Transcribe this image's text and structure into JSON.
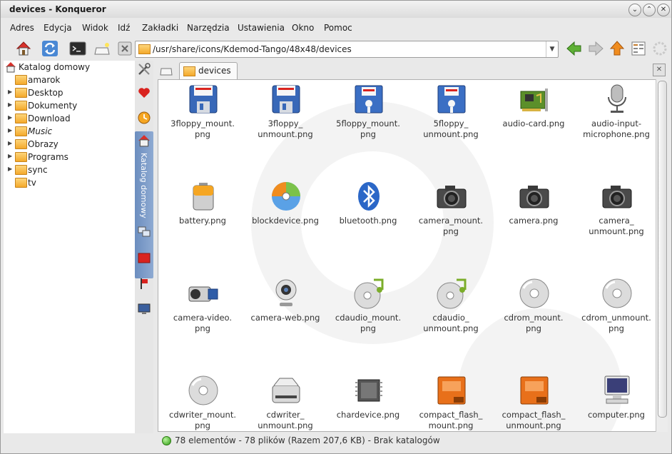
{
  "window": {
    "title": "devices - Konqueror"
  },
  "menu": [
    "Adres",
    "Edycja",
    "Widok",
    "Idź",
    "Zakładki",
    "Narzędzia",
    "Ustawienia",
    "Okno",
    "Pomoc"
  ],
  "location": {
    "url": "/usr/share/icons/Kdemod-Tango/48x48/devices"
  },
  "tab": {
    "label": "devices"
  },
  "sidebar": {
    "root": "Katalog domowy",
    "items": [
      {
        "label": "amarok",
        "expandable": false,
        "italic": false
      },
      {
        "label": "Desktop",
        "expandable": true,
        "italic": false
      },
      {
        "label": "Dokumenty",
        "expandable": true,
        "italic": false
      },
      {
        "label": "Download",
        "expandable": true,
        "italic": false
      },
      {
        "label": "Music",
        "expandable": true,
        "italic": true
      },
      {
        "label": "Obrazy",
        "expandable": true,
        "italic": false
      },
      {
        "label": "Programs",
        "expandable": true,
        "italic": false
      },
      {
        "label": "sync",
        "expandable": true,
        "italic": false
      },
      {
        "label": "tv",
        "expandable": false,
        "italic": false
      }
    ],
    "vertical_tab_label": "Katalog domowy"
  },
  "files": [
    {
      "label": "3floppy_mount.\npng",
      "icon": "floppy-icon"
    },
    {
      "label": "3floppy_\nunmount.png",
      "icon": "floppy-icon"
    },
    {
      "label": "5floppy_mount.\npng",
      "icon": "floppy-5-icon"
    },
    {
      "label": "5floppy_\nunmount.png",
      "icon": "floppy-5-icon"
    },
    {
      "label": "audio-card.png",
      "icon": "audio-card-icon"
    },
    {
      "label": "audio-input-\nmicrophone.png",
      "icon": "microphone-icon"
    },
    {
      "label": "battery.png",
      "icon": "battery-icon"
    },
    {
      "label": "blockdevice.png",
      "icon": "blockdevice-icon"
    },
    {
      "label": "bluetooth.png",
      "icon": "bluetooth-icon"
    },
    {
      "label": "camera_mount.\npng",
      "icon": "camera-icon"
    },
    {
      "label": "camera.png",
      "icon": "camera-icon"
    },
    {
      "label": "camera_\nunmount.png",
      "icon": "camera-icon"
    },
    {
      "label": "camera-video.\npng",
      "icon": "camera-video-icon"
    },
    {
      "label": "camera-web.png",
      "icon": "webcam-icon"
    },
    {
      "label": "cdaudio_mount.\npng",
      "icon": "cdaudio-icon"
    },
    {
      "label": "cdaudio_\nunmount.png",
      "icon": "cdaudio-icon"
    },
    {
      "label": "cdrom_mount.\npng",
      "icon": "cdrom-icon"
    },
    {
      "label": "cdrom_unmount.\npng",
      "icon": "cdrom-icon"
    },
    {
      "label": "cdwriter_mount.\npng",
      "icon": "cdrom-icon"
    },
    {
      "label": "cdwriter_\nunmount.png",
      "icon": "cdwriter-icon"
    },
    {
      "label": "chardevice.png",
      "icon": "chip-icon"
    },
    {
      "label": "compact_flash_\nmount.png",
      "icon": "compact-flash-icon"
    },
    {
      "label": "compact_flash_\nunmount.png",
      "icon": "compact-flash-icon"
    },
    {
      "label": "computer.png",
      "icon": "computer-icon"
    }
  ],
  "status": {
    "text": "78 elementów - 78 plików (Razem 207,6 KB) - Brak katalogów"
  },
  "colors": {
    "accent": "#6c8ebf",
    "folder": "#f4a92b",
    "status_ok": "#2e9a14"
  }
}
